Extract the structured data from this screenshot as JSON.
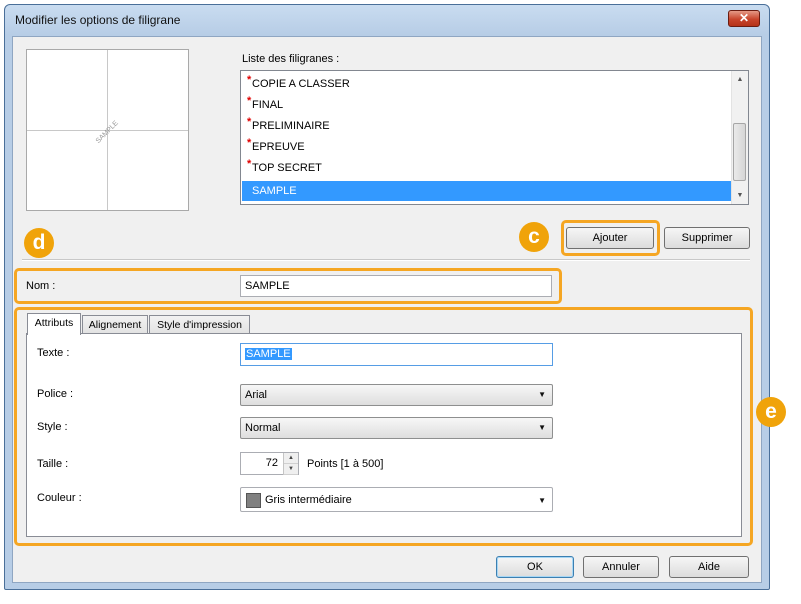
{
  "window": {
    "title": "Modifier les options de filigrane",
    "close_glyph": "✕"
  },
  "preview": {
    "sample_text": "SAMPLE"
  },
  "watermark_list": {
    "label": "Liste des filigranes :",
    "items": [
      {
        "label": "COPIE A CLASSER",
        "predefined": true
      },
      {
        "label": "FINAL",
        "predefined": true
      },
      {
        "label": "PRELIMINAIRE",
        "predefined": true
      },
      {
        "label": "EPREUVE",
        "predefined": true
      },
      {
        "label": "TOP SECRET",
        "predefined": true
      },
      {
        "label": "SAMPLE",
        "predefined": false,
        "selected": true
      }
    ],
    "marker": "*"
  },
  "buttons": {
    "add": "Ajouter",
    "delete": "Supprimer",
    "ok": "OK",
    "cancel": "Annuler",
    "help": "Aide"
  },
  "callouts": {
    "c": "c",
    "d": "d",
    "e": "e"
  },
  "name_field": {
    "label": "Nom :",
    "value": "SAMPLE"
  },
  "tabs": [
    {
      "label": "Attributs",
      "active": true
    },
    {
      "label": "Alignement",
      "active": false
    },
    {
      "label": "Style d'impression",
      "active": false
    }
  ],
  "attributes": {
    "text": {
      "label": "Texte :",
      "value": "SAMPLE"
    },
    "font": {
      "label": "Police :",
      "value": "Arial"
    },
    "style": {
      "label": "Style :",
      "value": "Normal"
    },
    "size": {
      "label": "Taille :",
      "value": "72",
      "unit": "Points [1 à 500]"
    },
    "color": {
      "label": "Couleur :",
      "value": "Gris intermédiaire",
      "swatch": "#808080"
    }
  },
  "colors": {
    "highlight": "#f5a623",
    "badge": "#f0a30a",
    "selection": "#3399ff",
    "marker": "#e00000"
  }
}
